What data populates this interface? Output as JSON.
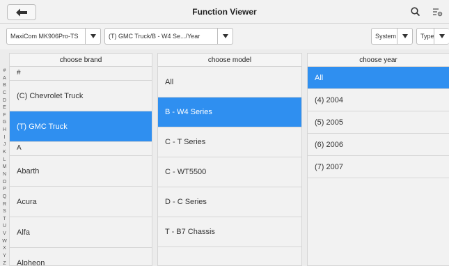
{
  "header": {
    "title": "Function Viewer"
  },
  "selectors": {
    "vehicle": "MaxiCom MK906Pro-TS",
    "model_path": "(T) GMC Truck/B - W4 Se.../Year",
    "system": "System",
    "type": "Type"
  },
  "brand_column": {
    "header": "choose brand",
    "alphabet": [
      "#",
      "A",
      "B",
      "C",
      "D",
      "E",
      "F",
      "G",
      "H",
      "I",
      "J",
      "K",
      "L",
      "M",
      "N",
      "O",
      "P",
      "Q",
      "R",
      "S",
      "T",
      "U",
      "V",
      "W",
      "X",
      "Y",
      "Z"
    ],
    "items": [
      {
        "label": "#",
        "kind": "letter"
      },
      {
        "label": "(C) Chevrolet Truck",
        "kind": "item"
      },
      {
        "label": "(T) GMC Truck",
        "kind": "item",
        "selected": true
      },
      {
        "label": "A",
        "kind": "letter"
      },
      {
        "label": "Abarth",
        "kind": "item"
      },
      {
        "label": "Acura",
        "kind": "item"
      },
      {
        "label": "Alfa",
        "kind": "item"
      },
      {
        "label": "Alpheon",
        "kind": "item"
      }
    ]
  },
  "model_column": {
    "header": "choose model",
    "items": [
      {
        "label": "All"
      },
      {
        "label": "B - W4 Series",
        "selected": true
      },
      {
        "label": "C - T Series"
      },
      {
        "label": "C - WT5500"
      },
      {
        "label": "D - C Series"
      },
      {
        "label": "T - B7 Chassis"
      }
    ]
  },
  "year_column": {
    "header": "choose year",
    "items": [
      {
        "label": "All",
        "selected": true
      },
      {
        "label": "(4) 2004"
      },
      {
        "label": "(5) 2005"
      },
      {
        "label": "(6) 2006"
      },
      {
        "label": "(7) 2007"
      }
    ]
  },
  "colors": {
    "selected": "#2f8ff0",
    "background": "#f2f2f2"
  }
}
